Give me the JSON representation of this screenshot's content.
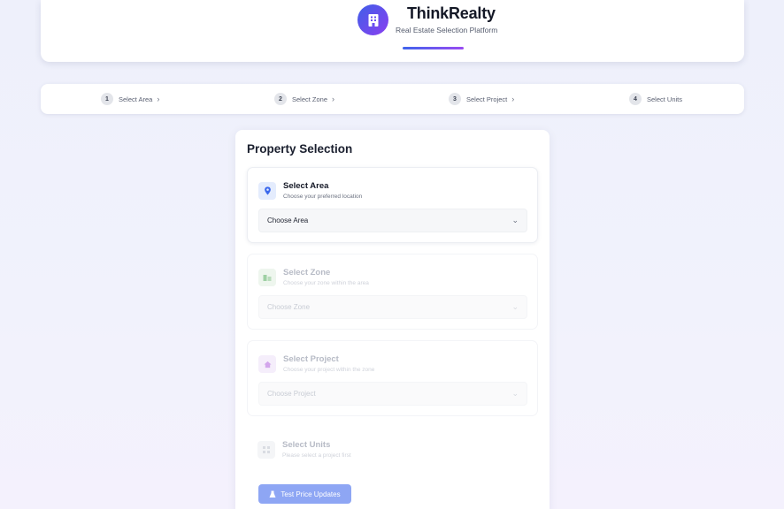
{
  "header": {
    "title": "ThinkRealty",
    "subtitle": "Real Estate Selection Platform",
    "logo_icon": "building-icon",
    "accent_start": "#3f5fe8",
    "accent_end": "#8a3ff0"
  },
  "stepper": {
    "steps": [
      {
        "number": "1",
        "label": "Select Area"
      },
      {
        "number": "2",
        "label": "Select Zone"
      },
      {
        "number": "3",
        "label": "Select Project"
      },
      {
        "number": "4",
        "label": "Select Units"
      }
    ],
    "chevron": "›"
  },
  "main": {
    "title": "Property Selection",
    "sections": [
      {
        "title": "Select Area",
        "subtitle": "Choose your preferred location",
        "placeholder": "Choose Area",
        "icon": "map-pin-icon",
        "state": "active"
      },
      {
        "title": "Select Zone",
        "subtitle": "Choose your zone within the area",
        "placeholder": "Choose Zone",
        "icon": "buildings-icon",
        "state": "disabled"
      },
      {
        "title": "Select Project",
        "subtitle": "Choose your project within the zone",
        "placeholder": "Choose Project",
        "icon": "home-icon",
        "state": "disabled"
      },
      {
        "title": "Select Units",
        "subtitle": "Please select a project first",
        "icon": "grid-icon",
        "state": "disabled"
      }
    ],
    "test_button_label": "Test Price Updates",
    "test_button_icon": "flask-icon"
  }
}
